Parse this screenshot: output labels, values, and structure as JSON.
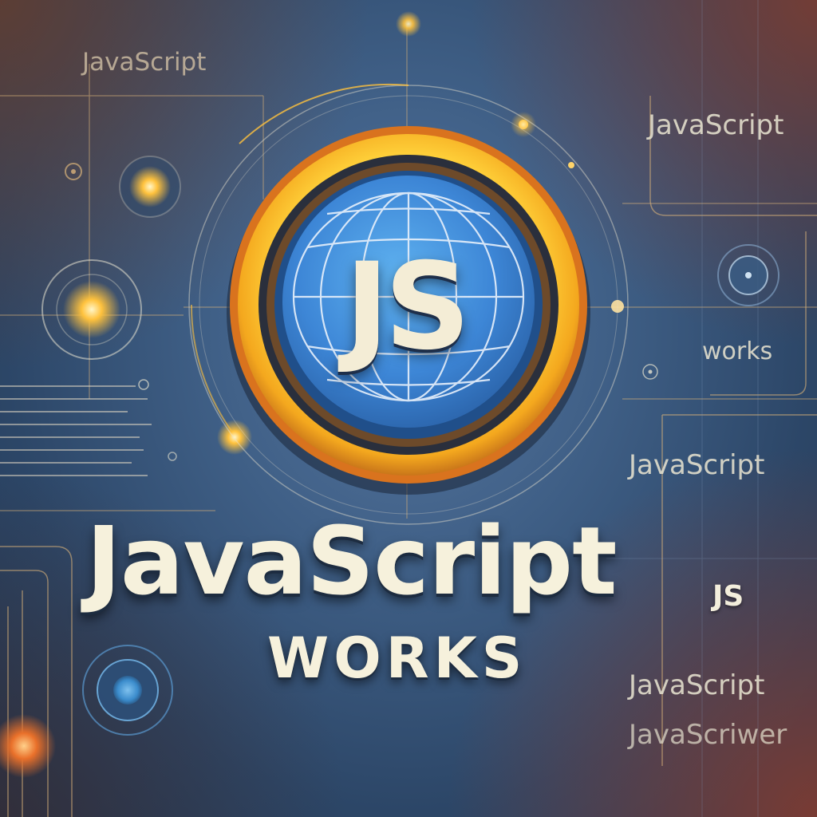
{
  "background": {
    "base_color": "#3f5f86",
    "accent_glow": "#ffc23d",
    "ring_color": "#f4a81e",
    "globe_color": "#3f86d8"
  },
  "emblem": {
    "icon": "globe-icon",
    "badge_text": "JS"
  },
  "headline": {
    "title": "JavaScript",
    "suffix": "JS",
    "subtitle": "WORKS"
  },
  "side_labels": {
    "top_left": "JavaScript",
    "right_top": "JavaScript",
    "right_works": "works",
    "right_middle": "JavaScript",
    "right_bottom_1": "JavaScript",
    "right_bottom_2": "JavaScriwer"
  }
}
